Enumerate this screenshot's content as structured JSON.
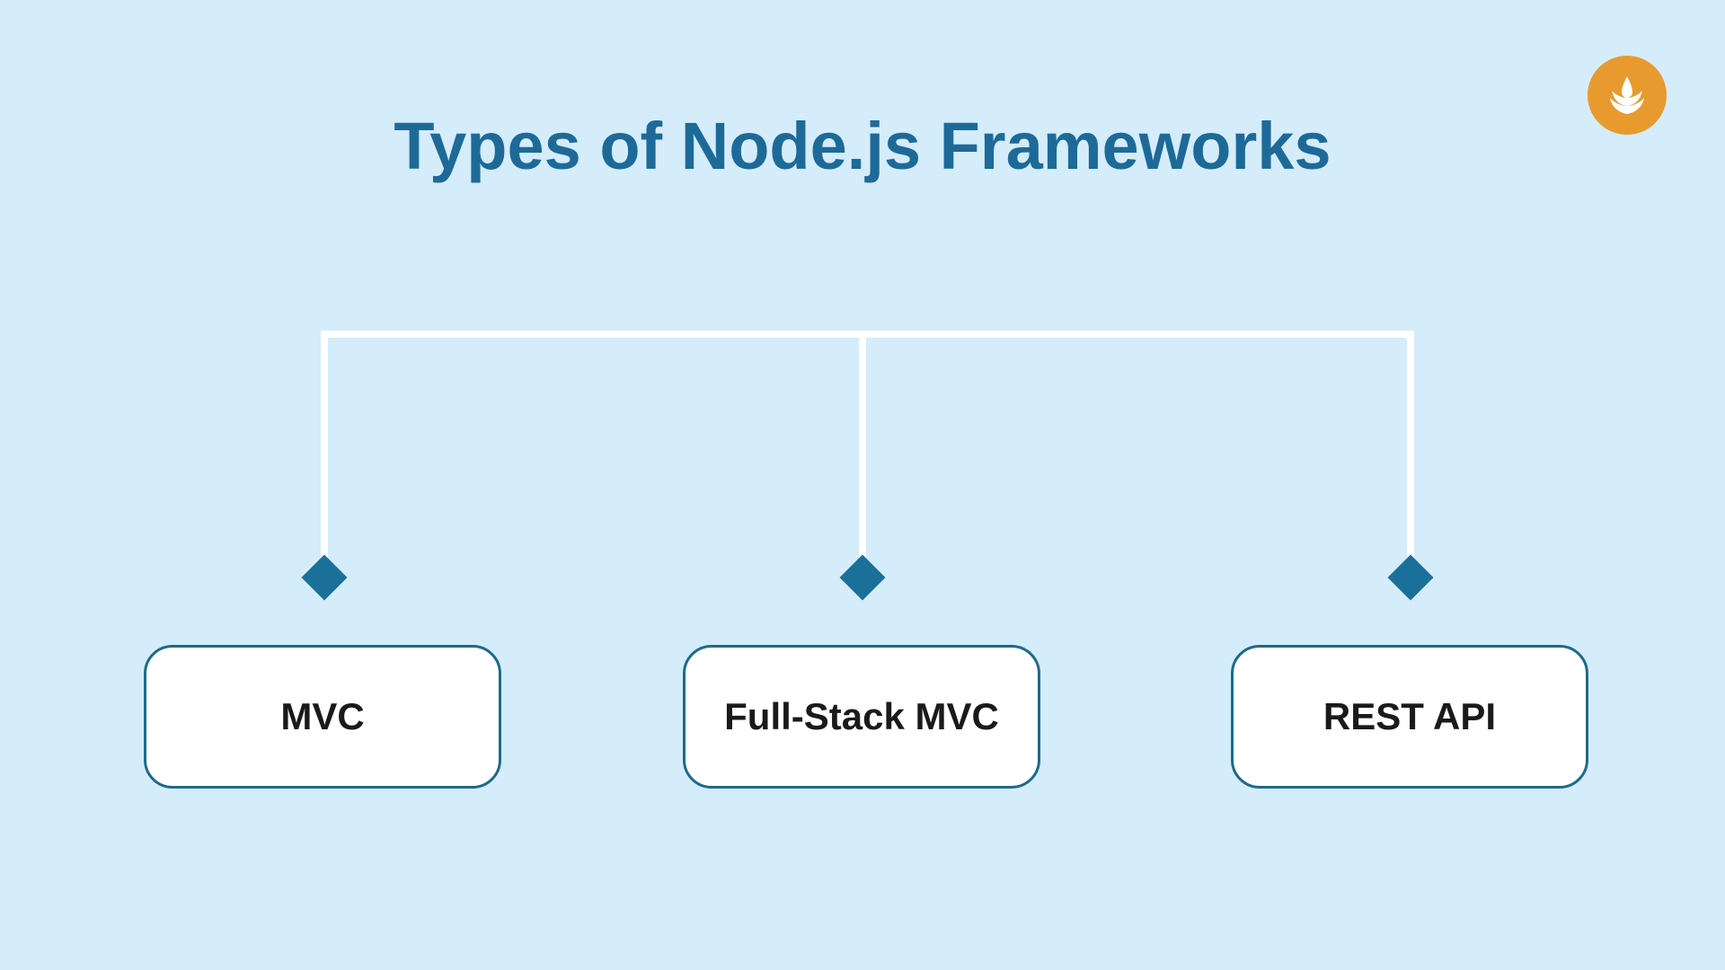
{
  "title": "Types of Node.js Frameworks",
  "logo": {
    "name": "lotus-flame-icon",
    "bg_color": "#e89a2e"
  },
  "categories": [
    {
      "label": "MVC"
    },
    {
      "label": "Full-Stack MVC"
    },
    {
      "label": "REST API"
    }
  ],
  "colors": {
    "background": "#d5ecfa",
    "title": "#1d6a99",
    "accent": "#1a7099",
    "card_border": "#1d6a8a",
    "card_bg": "#ffffff",
    "connector": "#ffffff"
  }
}
